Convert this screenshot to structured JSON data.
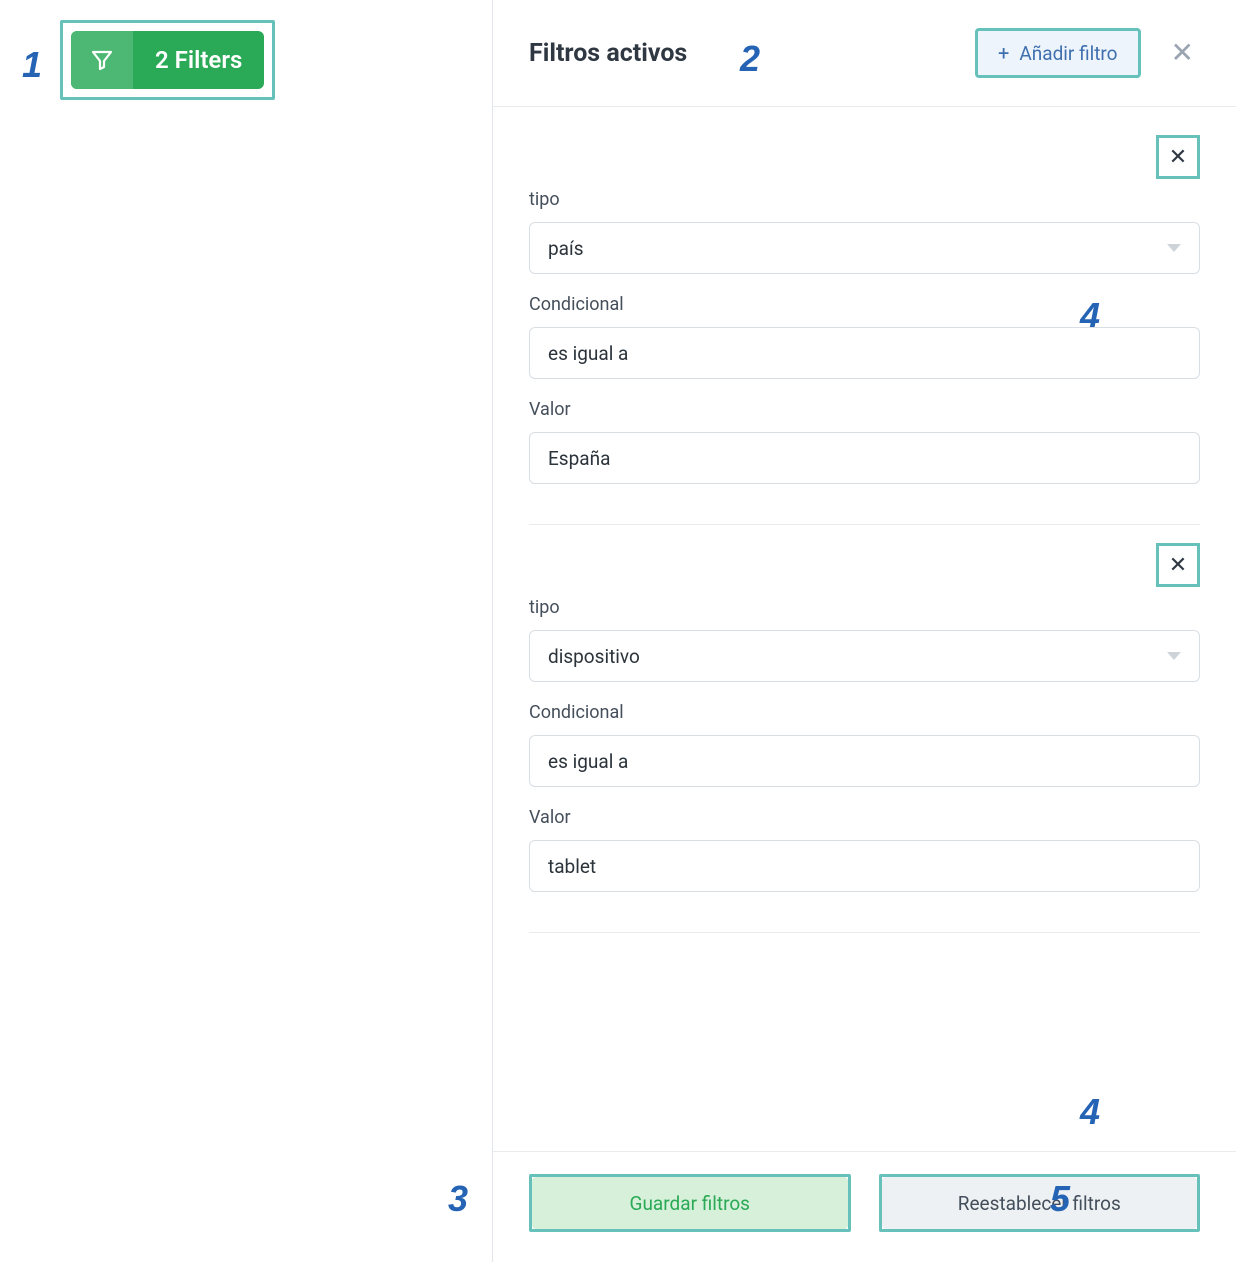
{
  "chip": {
    "label": "2 Filters"
  },
  "panel": {
    "title": "Filtros activos",
    "add_filter_label": "Añadir filtro"
  },
  "labels": {
    "type": "tipo",
    "conditional": "Condicional",
    "value": "Valor"
  },
  "filters": [
    {
      "type_value": "país",
      "conditional_value": "es igual a",
      "value_value": "España"
    },
    {
      "type_value": "dispositivo",
      "conditional_value": "es igual a",
      "value_value": "tablet"
    }
  ],
  "footer": {
    "save_label": "Guardar filtros",
    "reset_label": "Reestablecer filtros"
  },
  "annotations": {
    "a1": "1",
    "a2": "2",
    "a3": "3",
    "a4": "4",
    "a5": "5"
  }
}
